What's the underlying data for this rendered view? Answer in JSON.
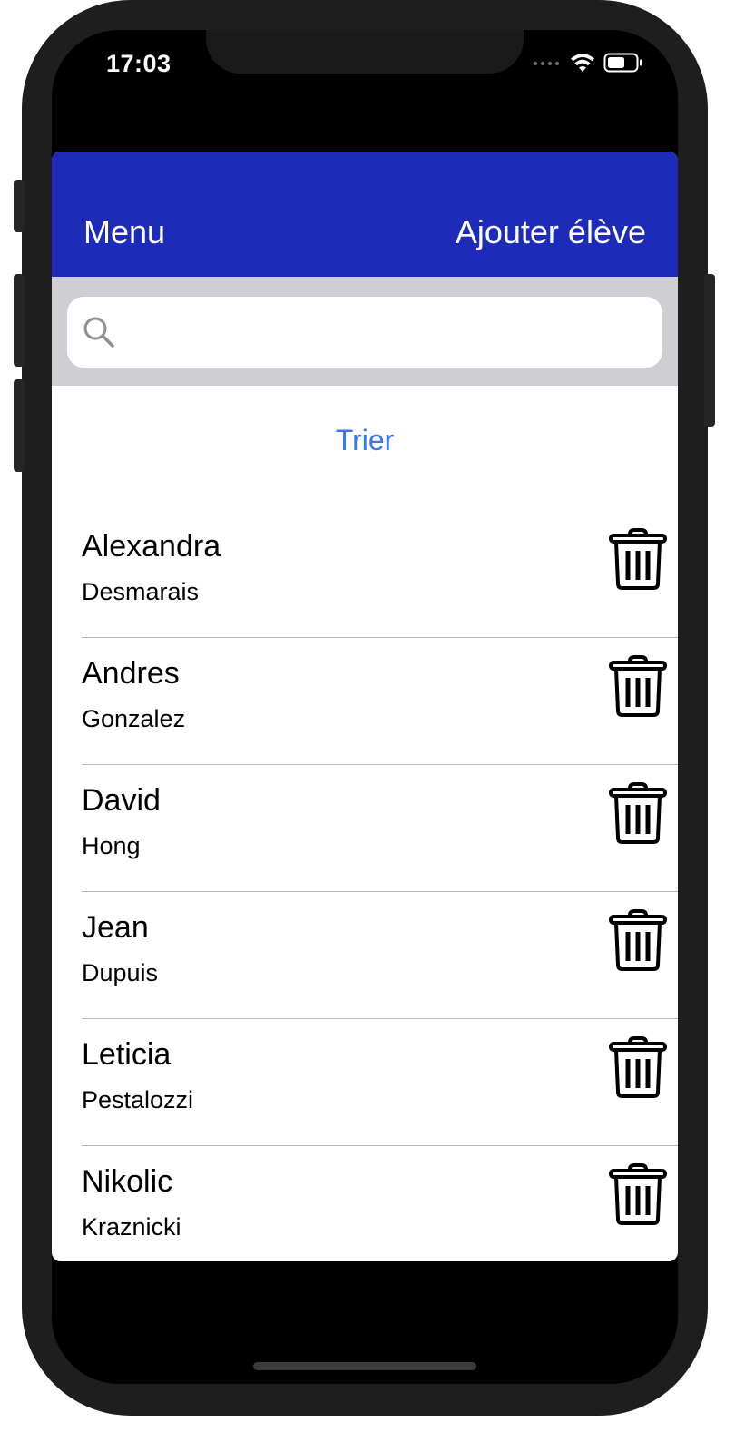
{
  "status_bar": {
    "time": "17:03"
  },
  "nav": {
    "left_label": "Menu",
    "right_label": "Ajouter élève"
  },
  "search": {
    "placeholder": "",
    "value": ""
  },
  "sort_label": "Trier",
  "students": [
    {
      "first": "Alexandra",
      "last": "Desmarais"
    },
    {
      "first": "Andres",
      "last": "Gonzalez"
    },
    {
      "first": "David",
      "last": "Hong"
    },
    {
      "first": "Jean",
      "last": "Dupuis"
    },
    {
      "first": "Leticia",
      "last": "Pestalozzi"
    },
    {
      "first": "Nikolic",
      "last": "Kraznicki"
    }
  ],
  "icons": {
    "search": "search-icon",
    "delete": "trash-icon",
    "wifi": "wifi-icon",
    "battery": "battery-icon",
    "signal": "signal-icon"
  },
  "colors": {
    "nav_background": "#1c2bb8",
    "accent": "#3478f6",
    "search_bar_background": "#cfced3"
  }
}
